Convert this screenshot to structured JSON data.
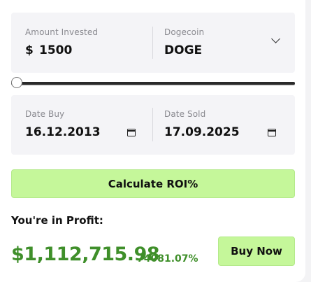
{
  "investment": {
    "amount_label": "Amount Invested",
    "currency_symbol": "$",
    "amount_value": "1500",
    "coin_label": "Dogecoin",
    "coin_value": "DOGE",
    "dropdown_icon": "chevron-down-icon"
  },
  "slider": {
    "level": 0.02
  },
  "dates": {
    "buy_label": "Date Buy",
    "buy_value": "16.12.2013",
    "sold_label": "Date Sold",
    "sold_value": "17.09.2025",
    "icon": "calendar-icon"
  },
  "actions": {
    "calculate_label": "Calculate ROI%",
    "buy_label": "Buy Now"
  },
  "result": {
    "status_label": "You're in Profit:",
    "amount": "$1,112,715.98",
    "percent": "74081.07%"
  },
  "colors": {
    "accent": "#c5f79a",
    "profit": "#3f8f2a",
    "panel": "#f4f4f7"
  }
}
